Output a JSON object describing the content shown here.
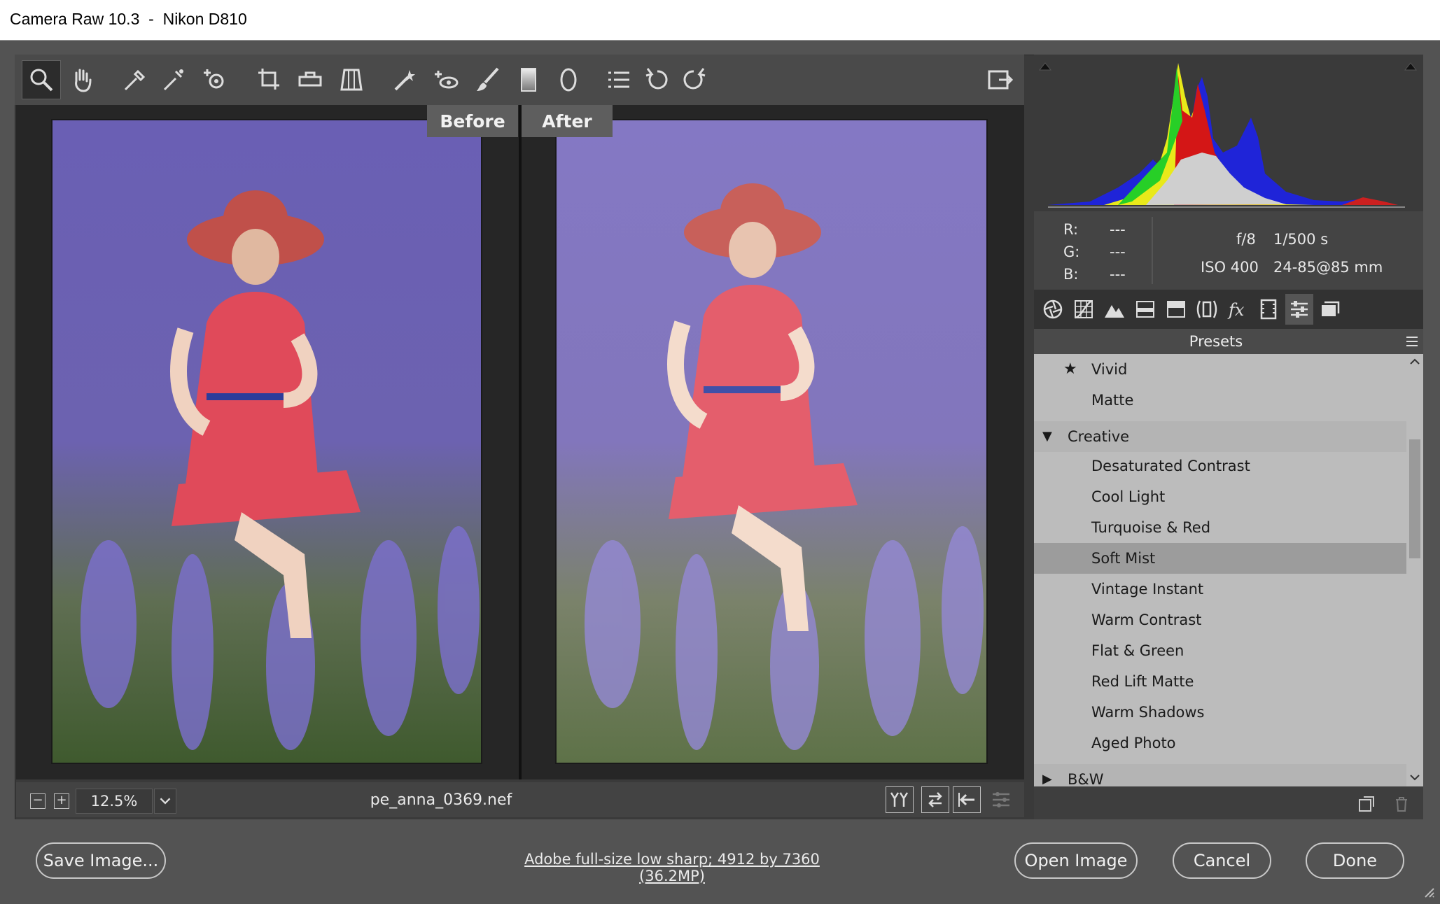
{
  "window": {
    "title": "Camera Raw 10.3  -  Nikon D810"
  },
  "compare": {
    "before_label": "Before",
    "after_label": "After"
  },
  "toolbar": {
    "tools": [
      "zoom-tool",
      "hand-tool",
      "white-balance-tool",
      "color-sampler-tool",
      "targeted-adjustment-tool",
      "crop-tool",
      "straighten-tool",
      "transform-tool",
      "spot-removal-tool",
      "red-eye-tool",
      "adjustment-brush-tool",
      "graduated-filter-tool",
      "radial-filter-tool",
      "preferences-tool",
      "rotate-left-tool",
      "rotate-right-tool"
    ],
    "fullscreen": "toggle-fullscreen"
  },
  "status": {
    "zoom": "12.5%",
    "filename": "pe_anna_0369.nef"
  },
  "info": {
    "r_label": "R:",
    "r_value": "---",
    "g_label": "G:",
    "g_value": "---",
    "b_label": "B:",
    "b_value": "---",
    "aperture": "f/8",
    "shutter": "1/500 s",
    "iso": "ISO 400",
    "lens": "24-85@85 mm"
  },
  "panel": {
    "title": "Presets",
    "rows": [
      {
        "label": "Vivid",
        "starred": true,
        "kind": "item"
      },
      {
        "label": "Matte",
        "kind": "item"
      },
      {
        "label": "Creative",
        "kind": "group-open"
      },
      {
        "label": "Desaturated Contrast",
        "kind": "item"
      },
      {
        "label": "Cool Light",
        "kind": "item"
      },
      {
        "label": "Turquoise & Red",
        "kind": "item"
      },
      {
        "label": "Soft Mist",
        "kind": "item",
        "selected": true
      },
      {
        "label": "Vintage Instant",
        "kind": "item"
      },
      {
        "label": "Warm Contrast",
        "kind": "item"
      },
      {
        "label": "Flat & Green",
        "kind": "item"
      },
      {
        "label": "Red Lift Matte",
        "kind": "item"
      },
      {
        "label": "Warm Shadows",
        "kind": "item"
      },
      {
        "label": "Aged Photo",
        "kind": "item"
      },
      {
        "label": "B&W",
        "kind": "group-closed"
      }
    ]
  },
  "footer": {
    "save": "Save Image...",
    "workflow": "Adobe full-size low sharp; 4912 by 7360 (36.2MP)",
    "open": "Open Image",
    "cancel": "Cancel",
    "done": "Done"
  },
  "colors": {
    "accent_selected": "#9c9c9c",
    "panel_bg": "#bcbcbc",
    "dress": "#e05060",
    "lavender": "#7a6cc0"
  }
}
